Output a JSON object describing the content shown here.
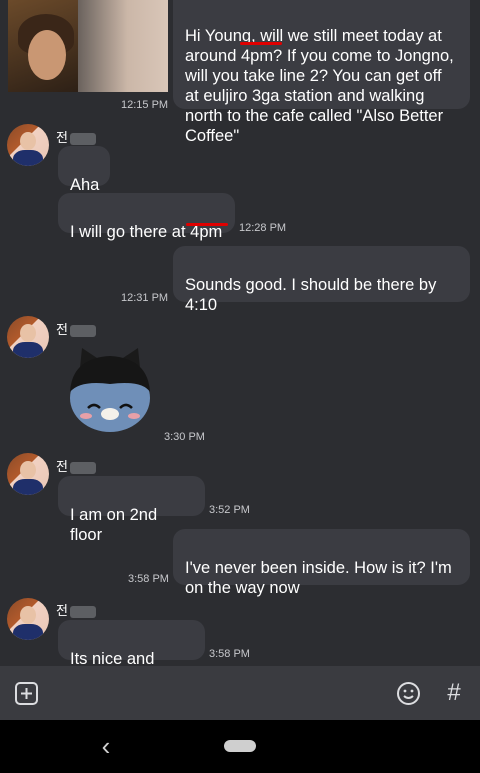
{
  "messages": {
    "m1": {
      "text": "Hi Young, will we still meet today at around 4pm? If you come to Jongno, will you take line 2? You can get off at euljiro 3ga station and walking north to the cafe called \"Also Better Coffee\"",
      "time": "12:15 PM"
    },
    "m2": {
      "sender": "전",
      "text": "Aha"
    },
    "m3": {
      "text": "I will go there at 4pm",
      "time": "12:28 PM"
    },
    "m4": {
      "text": "Sounds good. I should be there by 4:10",
      "time": "12:31 PM"
    },
    "m5": {
      "sender": "전",
      "sticker": "cat-sticker",
      "time": "3:30 PM"
    },
    "m6": {
      "sender": "전",
      "text": "I am on 2nd floor",
      "time": "3:52 PM"
    },
    "m7": {
      "text": "I've never been inside. How is it?  I'm on the way now",
      "time": "3:58 PM"
    },
    "m8": {
      "sender": "전",
      "text": "Its nice and calm",
      "time": "3:58 PM"
    }
  },
  "composer": {
    "add_icon": "plus-box-icon",
    "emoji_icon": "emoji-icon",
    "hash_icon": "#"
  },
  "nav": {
    "back_icon": "‹"
  },
  "colors": {
    "bubble": "#3b3c42",
    "background": "#2c2d31",
    "highlight": "#e00000"
  }
}
